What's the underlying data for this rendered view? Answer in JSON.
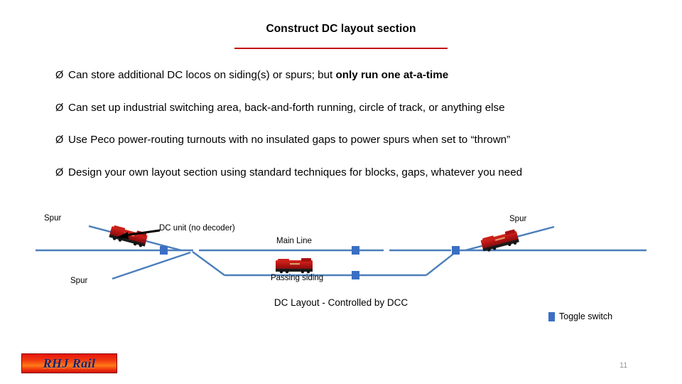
{
  "slide": {
    "title": "Construct DC layout section",
    "page_number": "11",
    "accent_rule_color": "#c00000"
  },
  "bullets": [
    {
      "marker": "Ø",
      "text_plain": "Can store additional DC locos on siding(s) or spurs; but only run one at-a-time",
      "lead": "Can store additional DC locos on siding(s) or spurs; but ",
      "bold": "only run one at-a-time",
      "tail": ""
    },
    {
      "marker": "Ø",
      "text_plain": "Can set up industrial switching area, back-and-forth running, circle of track, or anything else",
      "lead": "Can set up industrial switching area, back-and-forth running, circle of track, or anything else",
      "bold": "",
      "tail": ""
    },
    {
      "marker": "Ø",
      "text_plain": "Use Peco power-routing turnouts with no insulated gaps to power spurs when set to “thrown”",
      "lead": "Use Peco power-routing turnouts with no insulated gaps to power spurs when set to “thrown”",
      "bold": "",
      "tail": ""
    },
    {
      "marker": "Ø",
      "text_plain": "Design your own layout section using standard techniques for blocks, gaps, whatever you need",
      "lead": "Design your own layout section using standard techniques for blocks, gaps, whatever you need",
      "bold": "",
      "tail": ""
    }
  ],
  "diagram": {
    "caption": "DC Layout -  Controlled by DCC",
    "track_color": "#4a7ebb",
    "switch_color": "#3b6fc4",
    "loco_color": "#b81414",
    "annotation_arrow_color": "#000000",
    "labels": {
      "spur_top_left": "Spur",
      "spur_bottom_left": "Spur",
      "spur_right": "Spur",
      "main_line": "Main Line",
      "passing_siding": "Passing siding",
      "dc_unit": "DC unit (no decoder)"
    },
    "locomotives": [
      {
        "name": "dc-loco-left-spur",
        "position": "left spur"
      },
      {
        "name": "dc-loco-passing-siding",
        "position": "passing siding"
      },
      {
        "name": "dc-loco-right-spur",
        "position": "right spur"
      }
    ],
    "toggle_switch_count": 5
  },
  "legend": {
    "swatch_color": "#3b6fc4",
    "label": "Toggle switch"
  },
  "logo": {
    "text": "RHJ Rail"
  }
}
